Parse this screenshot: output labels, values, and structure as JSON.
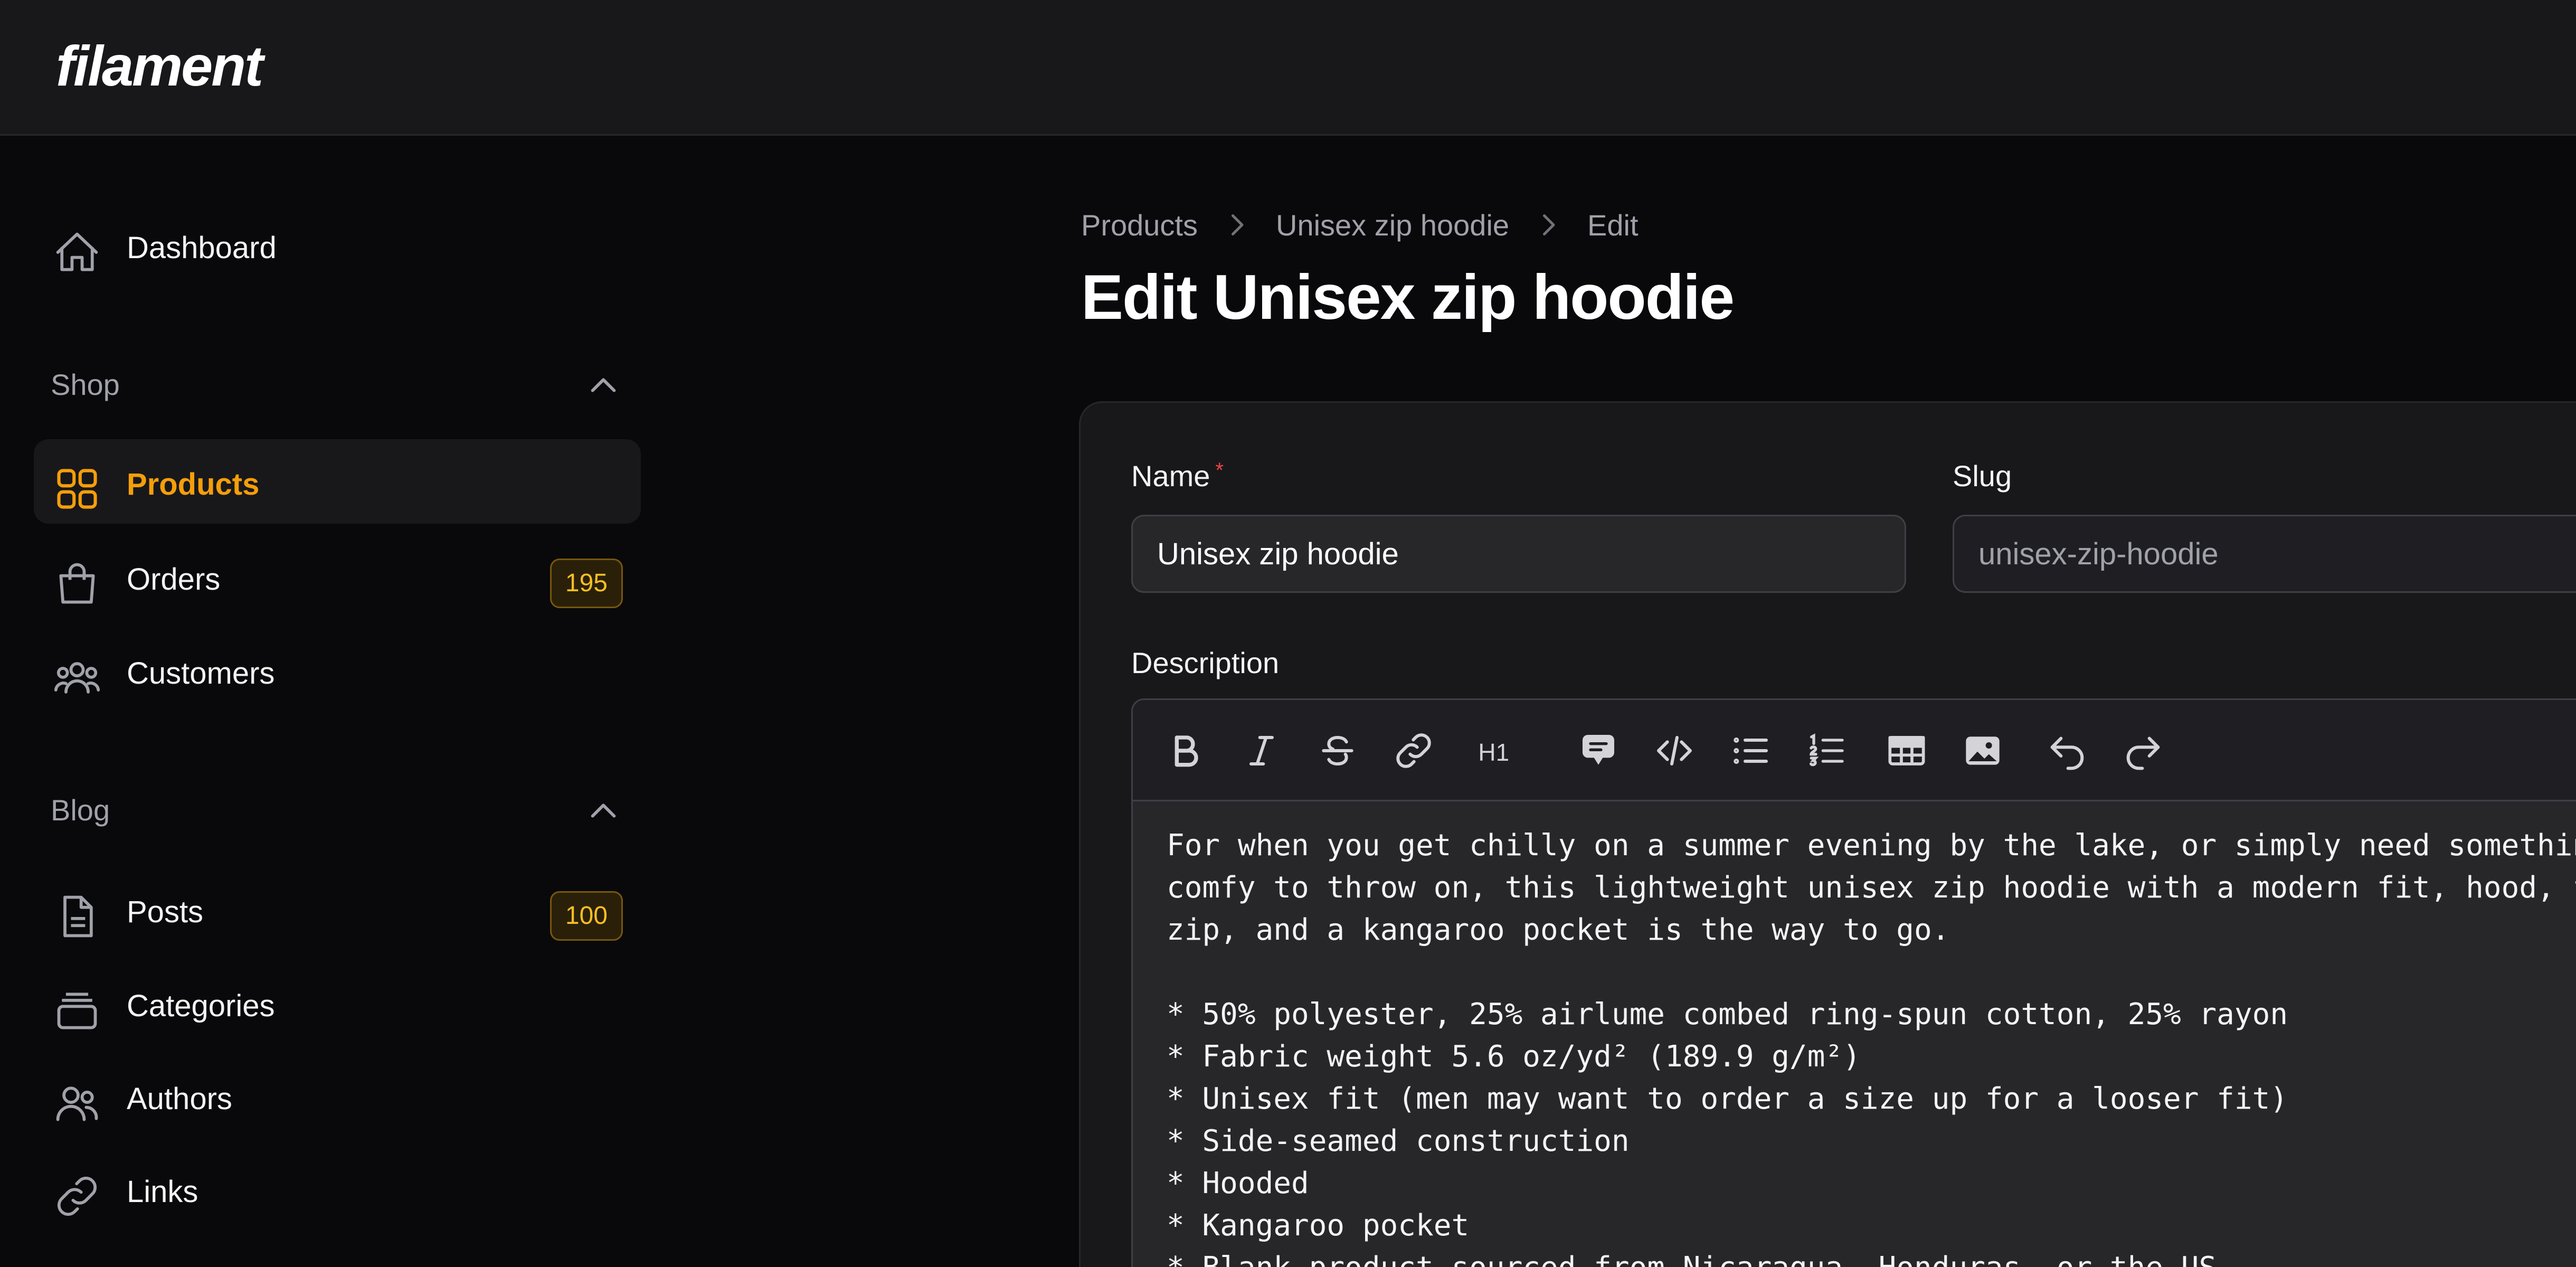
{
  "app": {
    "logo": "filament"
  },
  "sidebar": {
    "dashboard": {
      "label": "Dashboard",
      "icon": "home-icon"
    },
    "groups": [
      {
        "label": "Shop",
        "items": [
          {
            "label": "Products",
            "icon": "squares-icon",
            "active": true
          },
          {
            "label": "Orders",
            "icon": "shopping-bag-icon",
            "badge": "195"
          },
          {
            "label": "Customers",
            "icon": "user-group-icon"
          }
        ]
      },
      {
        "label": "Blog",
        "items": [
          {
            "label": "Posts",
            "icon": "document-icon",
            "badge": "100"
          },
          {
            "label": "Categories",
            "icon": "stack-icon"
          },
          {
            "label": "Authors",
            "icon": "users-icon"
          },
          {
            "label": "Links",
            "icon": "link-icon"
          }
        ]
      }
    ]
  },
  "breadcrumb": [
    "Products",
    "Unisex zip hoodie",
    "Edit"
  ],
  "page": {
    "title": "Edit Unisex zip hoodie"
  },
  "form": {
    "name": {
      "label": "Name",
      "required_mark": "*",
      "value": "Unisex zip hoodie"
    },
    "slug": {
      "label": "Slug",
      "value": "unisex-zip-hoodie"
    },
    "description": {
      "label": "Description",
      "toolbar": [
        "bold-icon",
        "italic-icon",
        "strike-icon",
        "link-icon",
        "heading-icon",
        "blockquote-icon",
        "code-icon",
        "bullet-list-icon",
        "ordered-list-icon",
        "table-icon",
        "image-icon",
        "undo-icon",
        "redo-icon"
      ],
      "heading_glyph": "H1",
      "content": "For when you get chilly on a summer evening by the lake, or simply need something\ncomfy to throw on, this lightweight unisex zip hoodie with a modern fit, hood, full\nzip, and a kangaroo pocket is the way to go.\n\n* 50% polyester, 25% airlume combed ring-spun cotton, 25% rayon\n* Fabric weight 5.6 oz/yd² (189.9 g/m²)\n* Unisex fit (men may want to order a size up for a looser fit)\n* Side-seamed construction\n* Hooded\n* Kangaroo pocket\n* Blank product sourced from Nicaragua, Honduras, or the US"
    }
  },
  "colors": {
    "accent": "#f59e0b",
    "badge_text": "#fbbf24",
    "required": "#ef4444"
  }
}
